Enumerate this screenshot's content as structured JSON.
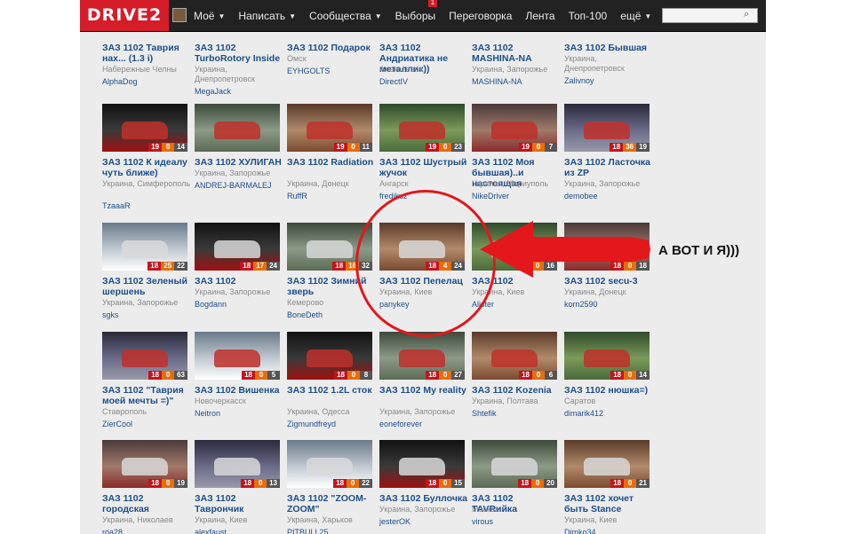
{
  "header": {
    "logo": "DRIVE2",
    "nav": [
      {
        "label": "Моё",
        "caret": true
      },
      {
        "label": "Написать",
        "caret": true
      },
      {
        "label": "Сообщества",
        "caret": true
      },
      {
        "label": "Выборы",
        "caret": false,
        "badge": "1"
      },
      {
        "label": "Переговорка",
        "caret": false
      },
      {
        "label": "Лента",
        "caret": false
      },
      {
        "label": "Топ-100",
        "caret": false
      },
      {
        "label": "ещё",
        "caret": true
      }
    ],
    "search_placeholder": ""
  },
  "annotation": "А ВОТ И Я)))",
  "rows": [
    [
      {
        "title": "ЗАЗ 1102 Таврия нах... (1.3 i)",
        "location": "Набережные Челны",
        "user": "AlphaDog",
        "counts": [
          "",
          "",
          ""
        ],
        "cut": true
      },
      {
        "title": "ЗАЗ 1102 TurboRotory Inside",
        "location": "Украина, Днепропетровск",
        "user": "MegaJack",
        "counts": [
          "",
          "",
          ""
        ],
        "cut": true
      },
      {
        "title": "ЗАЗ 1102 Подарок",
        "location": "Омск",
        "user": "EYHGOLTS",
        "counts": [
          "",
          "",
          ""
        ],
        "cut": true
      },
      {
        "title": "ЗАЗ 1102 Андриатика не металлик))",
        "location": "Алексеевка",
        "user": "DirectIV",
        "counts": [
          "",
          "",
          ""
        ],
        "cut": true
      },
      {
        "title": "ЗАЗ 1102 MASHINA-NA",
        "location": "Украина, Запорожье",
        "user": "MASHINA-NA",
        "counts": [
          "",
          "",
          ""
        ],
        "cut": true
      },
      {
        "title": "ЗАЗ 1102 Бывшая",
        "location": "Украина, Днепропетровск",
        "user": "Zalivnoy",
        "counts": [
          "",
          "",
          ""
        ],
        "cut": true
      }
    ],
    [
      {
        "title": "ЗАЗ 1102 К идеалу чуть ближе)",
        "location": "Украина, Симферополь",
        "user": "TzaaaR",
        "counts": [
          "19",
          "0",
          "14"
        ]
      },
      {
        "title": "ЗАЗ 1102 ХУЛИГАН",
        "location": "Украина, Запорожье",
        "user": "ANDREJ-BARMALEJ",
        "counts": [
          "",
          "",
          ""
        ]
      },
      {
        "title": "ЗАЗ 1102 Radiation",
        "location": "Украина, Донецк",
        "user": "RuffR",
        "counts": [
          "19",
          "0",
          "11"
        ]
      },
      {
        "title": "ЗАЗ 1102 Шустрый жучок",
        "location": "Ангарск",
        "user": "fredikuz",
        "counts": [
          "19",
          "0",
          "23"
        ]
      },
      {
        "title": "ЗАЗ 1102 Моя бывшая)..и настоящая",
        "location": "Украина, Мариуполь",
        "user": "NikeDriver",
        "counts": [
          "19",
          "0",
          "7"
        ]
      },
      {
        "title": "ЗАЗ 1102 Ласточка из ZP",
        "location": "Украина, Запорожье",
        "user": "demobee",
        "counts": [
          "18",
          "36",
          "19"
        ]
      }
    ],
    [
      {
        "title": "ЗАЗ 1102 Зеленый шершень",
        "location": "Украина, Запорожье",
        "user": "sgks",
        "counts": [
          "18",
          "25",
          "22"
        ]
      },
      {
        "title": "ЗАЗ 1102",
        "location": "Украина, Запорожье",
        "user": "Bogdann",
        "counts": [
          "18",
          "17",
          "24"
        ]
      },
      {
        "title": "ЗАЗ 1102 Зимний зверь",
        "location": "Кемерово",
        "user": "BoneDeth",
        "counts": [
          "18",
          "16",
          "32"
        ]
      },
      {
        "title": "ЗАЗ 1102 Пепелац",
        "location": "Украина, Киев",
        "user": "panykey",
        "counts": [
          "18",
          "4",
          "24"
        ]
      },
      {
        "title": "ЗАЗ 1102",
        "location": "Украина, Киев",
        "user": "Alister",
        "counts": [
          "18",
          "0",
          "16"
        ]
      },
      {
        "title": "ЗАЗ 1102 secu-3",
        "location": "Украина, Донецк",
        "user": "korn2590",
        "counts": [
          "18",
          "0",
          "18"
        ]
      }
    ],
    [
      {
        "title": "ЗАЗ 1102 \"Таврия моей мечты =)\"",
        "location": "Ставрополь",
        "user": "ZierCool",
        "counts": [
          "18",
          "0",
          "63"
        ]
      },
      {
        "title": "ЗАЗ 1102 Вишенка",
        "location": "Новочеркасск",
        "user": "Neitron",
        "counts": [
          "18",
          "0",
          "5"
        ]
      },
      {
        "title": "ЗАЗ 1102 1.2L сток",
        "location": "Украина, Одесса",
        "user": "Zigmundfreyd",
        "counts": [
          "18",
          "0",
          "8"
        ]
      },
      {
        "title": "ЗАЗ 1102 My reality",
        "location": "Украина, Запорожье",
        "user": "eoneforever",
        "counts": [
          "18",
          "0",
          "27"
        ]
      },
      {
        "title": "ЗАЗ 1102 Kozenia",
        "location": "Украина, Полтава",
        "user": "Shtefik",
        "counts": [
          "18",
          "0",
          "6"
        ]
      },
      {
        "title": "ЗАЗ 1102 нюшка=)",
        "location": "Саратов",
        "user": "dimarik412",
        "counts": [
          "18",
          "0",
          "14"
        ]
      }
    ],
    [
      {
        "title": "ЗАЗ 1102 городская",
        "location": "Украина, Николаев",
        "user": "roa28",
        "counts": [
          "18",
          "0",
          "19"
        ]
      },
      {
        "title": "ЗАЗ 1102 Таврончик",
        "location": "Украина, Киев",
        "user": "alexfaust",
        "counts": [
          "18",
          "0",
          "13"
        ]
      },
      {
        "title": "ЗАЗ 1102 \"ZOOM-ZOOM\"",
        "location": "Украина, Харьков",
        "user": "PITBULL25",
        "counts": [
          "18",
          "0",
          "22"
        ]
      },
      {
        "title": "ЗАЗ 1102 Буллочка",
        "location": "Украина, Запорожье",
        "user": "jesterOK",
        "counts": [
          "18",
          "0",
          "15"
        ]
      },
      {
        "title": "ЗАЗ 1102 TAVRийка",
        "location": "Москва",
        "user": "virous",
        "counts": [
          "18",
          "0",
          "20"
        ]
      },
      {
        "title": "ЗАЗ 1102 хочет быть Stance",
        "location": "Украина, Киев",
        "user": "Dimko34",
        "counts": [
          "18",
          "0",
          "21"
        ]
      }
    ]
  ],
  "colors": {
    "brand": "#d51d2a",
    "link": "#1d4e8c",
    "annotation": "#e3171c"
  }
}
